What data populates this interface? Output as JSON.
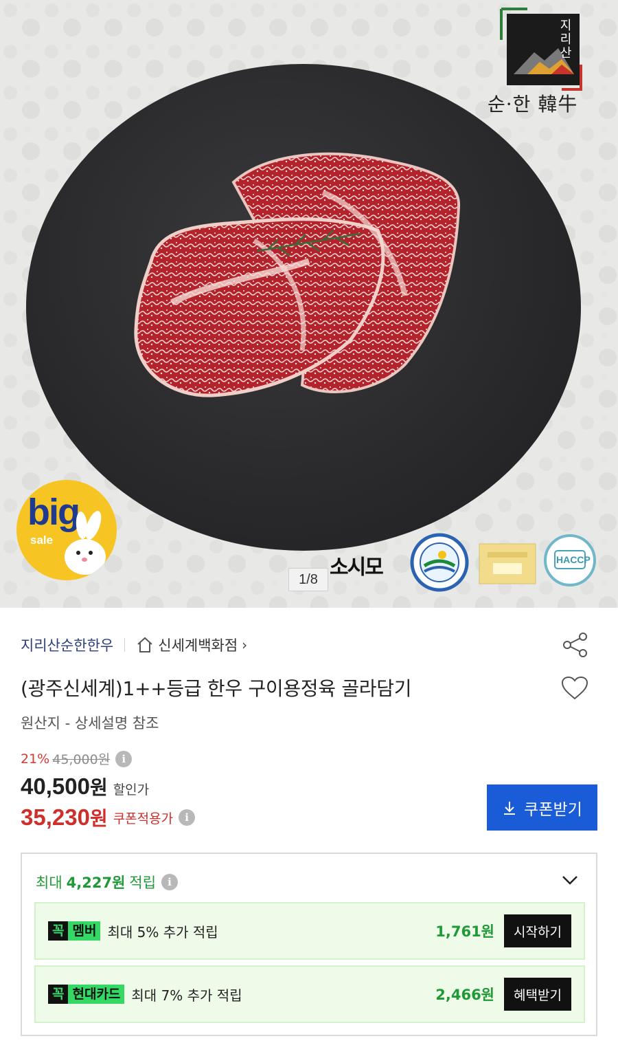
{
  "hero": {
    "brand_vertical": "지리산",
    "brand_wordmark": "순·한 韓牛",
    "big_sale_big": "big",
    "big_sale_sale": "sale",
    "badge_sosimo": "소시모",
    "badge_haccp": "HACCP",
    "image_counter": "1/8"
  },
  "store": {
    "name": "지리산순한한우",
    "shop": "신세계백화점",
    "shop_chevron": "›"
  },
  "product": {
    "title": "(광주신세계)1++등급 한우 구이용정육 골라담기",
    "origin": "원산지 - 상세설명 참조"
  },
  "price": {
    "discount_rate": "21%",
    "original_price": "45,000원",
    "sale_price": "40,500",
    "sale_unit": "원",
    "sale_label": "할인가",
    "coupon_price": "35,230",
    "coupon_unit": "원",
    "coupon_label": "쿠폰적용가",
    "coupon_button": "쿠폰받기",
    "info_glyph": "i"
  },
  "rewards": {
    "prefix": "최대",
    "amount": "4,227원",
    "suffix": "적립",
    "offers": [
      {
        "tag_k": "꼭",
        "tag_name": "멤버",
        "text": "최대 5% 추가 적립",
        "amount": "1,761원",
        "button": "시작하기"
      },
      {
        "tag_k": "꼭",
        "tag_name": "현대카드",
        "text": "최대 7% 추가 적립",
        "amount": "2,466원",
        "button": "혜택받기"
      }
    ]
  },
  "colors": {
    "accent_blue": "#1a5bd8",
    "price_red": "#cf2f2a",
    "reward_green": "#1f9a37",
    "store_navy": "#2a3f7c"
  },
  "icons": [
    "home-icon",
    "share-icon",
    "heart-icon",
    "info-icon",
    "download-icon",
    "chevron-down-icon"
  ]
}
